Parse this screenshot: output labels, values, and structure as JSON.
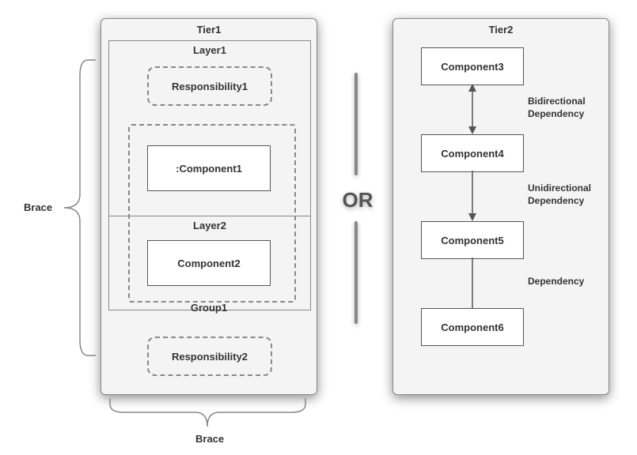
{
  "tier1": {
    "title": "Tier1",
    "layer1_title": "Layer1",
    "layer2_title": "Layer2",
    "responsibility1": "Responsibility1",
    "responsibility2": "Responsibility2",
    "component1": ":Component1",
    "component2": "Component2",
    "group_label": "Group1"
  },
  "tier2": {
    "title": "Tier2",
    "component3": "Component3",
    "component4": "Component4",
    "component5": "Component5",
    "component6": "Component6",
    "dep_bidirectional_1": "Bidirectional",
    "dep_bidirectional_2": "Dependency",
    "dep_unidirectional_1": "Unidirectional",
    "dep_unidirectional_2": "Dependency",
    "dep_plain": "Dependency"
  },
  "connector": "OR",
  "brace_left": "Brace",
  "brace_bottom": "Brace"
}
